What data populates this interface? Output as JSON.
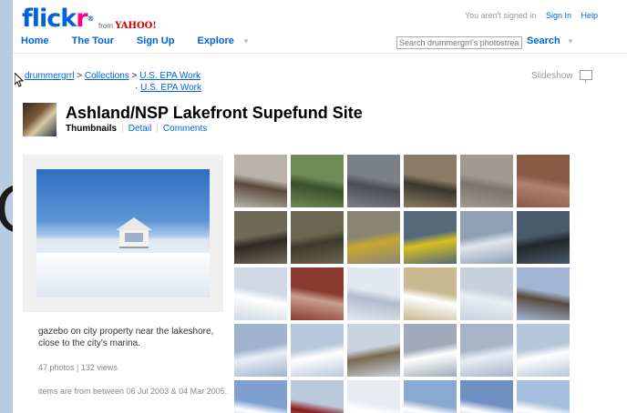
{
  "header": {
    "logo_part1": "flick",
    "logo_part2": "r",
    "logo_reg": "®",
    "from": "from",
    "yahoo": "YAHOO!",
    "signed_status": "You aren't signed in",
    "sign_in": "Sign In",
    "help": "Help"
  },
  "nav": {
    "items": [
      "Home",
      "The Tour",
      "Sign Up",
      "Explore"
    ],
    "search_placeholder": "Search drummergrrl's photostream",
    "search_label": "Search"
  },
  "breadcrumb": {
    "user": "drummergrrl",
    "sep1": " > ",
    "collections": "Collections",
    "sep2": " > ",
    "collection": "U.S. EPA Work",
    "sub_prefix": "· ",
    "collection2": "U.S. EPA Work"
  },
  "slideshow_label": "Slideshow",
  "set": {
    "title": "Ashland/NSP Lakefront Supefund Site",
    "tabs": {
      "thumbnails": "Thumbnails",
      "detail": "Detail",
      "comments": "Comments"
    },
    "description": "gazebo on city property near the lakeshore, close to the city's marina.",
    "counts": "47 photos | 132 views",
    "dates": "items are from between 06 Jul 2003 & 04 Mar 2005."
  },
  "thumb_colors": [
    [
      "#b8b2a8",
      "#6e8a55",
      "#7b8086",
      "#8a7b66",
      "#a09a90",
      "#8b5a46"
    ],
    [
      "#6f6a58",
      "#6b6650",
      "#8a8574",
      "#546a7a",
      "#8ea0b3",
      "#4a5a6a"
    ],
    [
      "#cfd8e4",
      "#8a3a30",
      "#e2e8f0",
      "#c9b890",
      "#c7d1dd",
      "#9fb7d4"
    ],
    [
      "#9fb3cf",
      "#b8c8dc",
      "#c9d3df",
      "#9fa9b8",
      "#a7b4c8",
      "#b6c6da"
    ],
    [
      "#7f9fcf",
      "#b9c8da",
      "#e8ecf2",
      "#8aa9d0",
      "#6f8fc2",
      "#a6bfdc"
    ]
  ],
  "thumb_accents": [
    [
      "#5b4a3c",
      "#3a4f2a",
      "#4a4e52",
      "#3b352c",
      "#7a746a",
      "#b08070"
    ],
    [
      "#2e2a22",
      "#3e3a2c",
      "#c8a832",
      "#d8c020",
      "#e0e6ee",
      "#20262c"
    ],
    [
      "#ffffff",
      "#c7a090",
      "#b0bccc",
      "#ffffff",
      "#e8eef6",
      "#5a4a40"
    ],
    [
      "#e8eef6",
      "#ffffff",
      "#7a6a50",
      "#ffffff",
      "#e8eef6",
      "#ffffff"
    ],
    [
      "#ffffff",
      "#8a1a1a",
      "#ffffff",
      "#ffffff",
      "#ffffff",
      "#ffffff"
    ]
  ]
}
